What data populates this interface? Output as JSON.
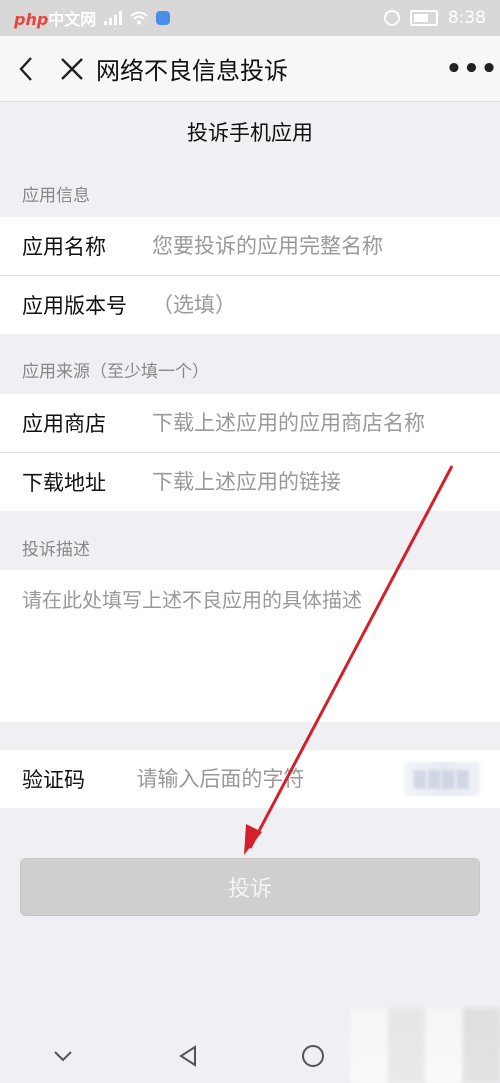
{
  "status_bar": {
    "watermark_brand": "php",
    "watermark_text": "中文网",
    "time": "8:38"
  },
  "nav": {
    "title": "网络不良信息投诉",
    "more_label": "•••"
  },
  "page_title": "投诉手机应用",
  "app_info": {
    "section_label": "应用信息",
    "name_label": "应用名称",
    "name_placeholder": "您要投诉的应用完整名称",
    "version_label": "应用版本号",
    "version_placeholder": "（选填）"
  },
  "app_source": {
    "section_label": "应用来源（至少填一个）",
    "store_label": "应用商店",
    "store_placeholder": "下载上述应用的应用商店名称",
    "url_label": "下载地址",
    "url_placeholder": "下载上述应用的链接"
  },
  "description": {
    "section_label": "投诉描述",
    "placeholder": "请在此处填写上述不良应用的具体描述"
  },
  "captcha": {
    "label": "验证码",
    "placeholder": "请输入后面的字符"
  },
  "submit_label": "投诉",
  "colors": {
    "annotation_arrow": "#d3202a",
    "submit_bg": "#cfcfcf"
  }
}
